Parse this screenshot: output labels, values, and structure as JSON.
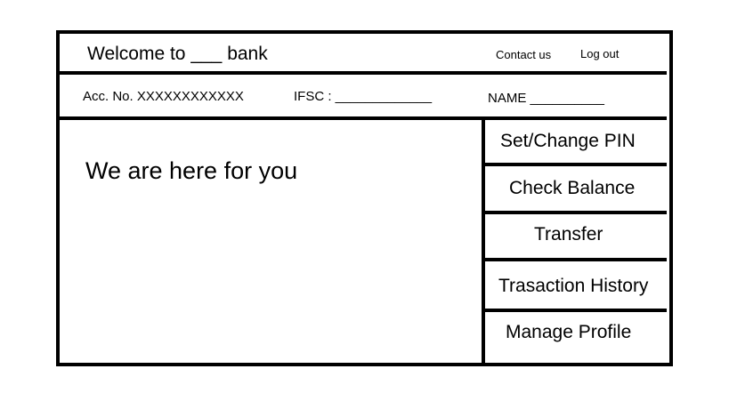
{
  "header": {
    "welcome_text": "Welcome to ___ bank",
    "contact_label": "Contact us",
    "logout_label": "Log out"
  },
  "account_bar": {
    "account_number": "Acc. No. XXXXXXXXXXXX",
    "ifsc": "IFSC : _____________",
    "name": "NAME __________"
  },
  "main": {
    "message": "We are here for you"
  },
  "menu": {
    "items": [
      {
        "label": "Set/Change PIN"
      },
      {
        "label": "Check Balance"
      },
      {
        "label": "Transfer"
      },
      {
        "label": "Trasaction History"
      },
      {
        "label": "Manage Profile"
      }
    ]
  }
}
